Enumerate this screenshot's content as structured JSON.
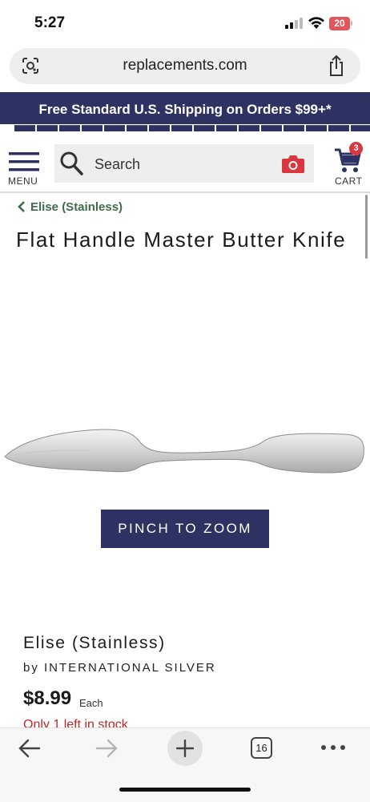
{
  "status_bar": {
    "time": "5:27",
    "battery": "20"
  },
  "browser": {
    "url": "replacements.com",
    "tab_count": "16"
  },
  "promo": {
    "text": "Free Standard U.S. Shipping on Orders $99+*"
  },
  "header": {
    "menu_label": "MENU",
    "search_placeholder": "Search",
    "cart_label": "CART",
    "cart_count": "3"
  },
  "breadcrumb": {
    "label": "Elise (Stainless)"
  },
  "product": {
    "title": "Flat Handle Master Butter Knife",
    "zoom_button": "PINCH TO ZOOM",
    "pattern": "Elise (Stainless)",
    "maker": "by INTERNATIONAL SILVER",
    "price": "$8.99",
    "price_unit": "Each",
    "stock": "Only 1 left in stock"
  },
  "icons": {
    "lens": "lens-icon",
    "share": "share-icon",
    "menu": "hamburger-menu-icon",
    "search": "search-icon",
    "camera": "camera-icon",
    "cart": "cart-icon",
    "back": "back-arrow-icon",
    "forward": "forward-arrow-icon",
    "new_tab": "plus-icon",
    "tabs": "tabs-icon",
    "more": "more-icon"
  },
  "colors": {
    "navy": "#2e3262",
    "badge_red": "#d9363e",
    "breadcrumb_green": "#3f6b4b",
    "stock_red": "#b52a2a"
  }
}
